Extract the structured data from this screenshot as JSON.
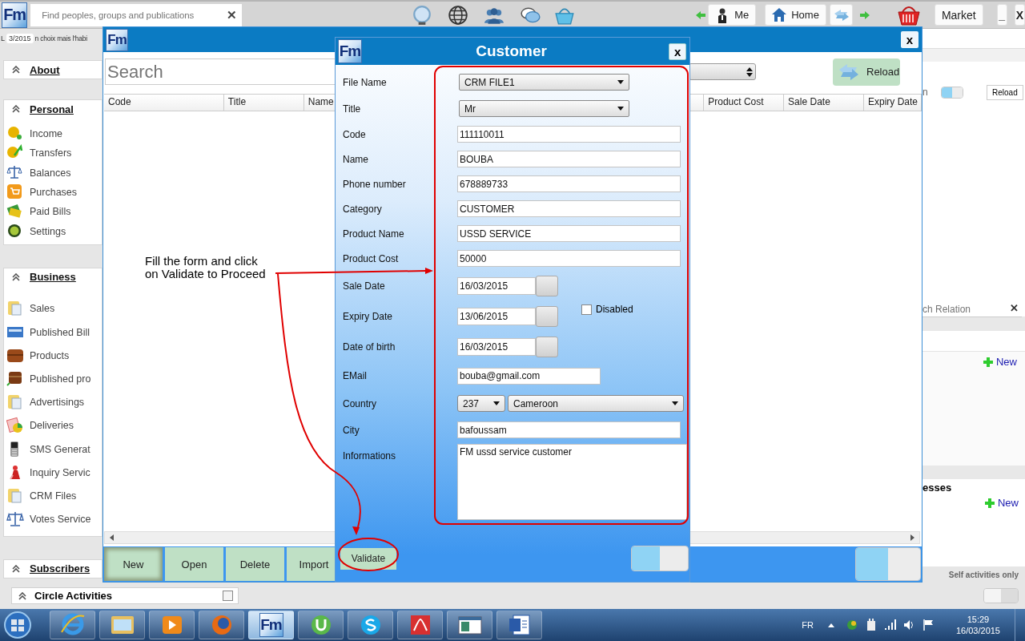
{
  "top_bar": {
    "logo": "Fm",
    "search": {
      "placeholder": "Find peoples, groups and publications",
      "clear": "✕"
    },
    "nav": [
      {
        "label": "Me"
      },
      {
        "label": "Home"
      }
    ],
    "market": "Market",
    "window_buttons": [
      "_",
      "X"
    ]
  },
  "sidebar": {
    "snippet_start": "L",
    "date_badge": "3/2015",
    "snippet": "n choix mais l'habi",
    "sections": [
      {
        "title": "About"
      },
      {
        "title": "Personal",
        "items": [
          "Income",
          "Transfers",
          "Balances",
          "Purchases",
          "Paid Bills",
          "Settings"
        ]
      },
      {
        "title": "Business",
        "items": [
          "Sales",
          "Published Bill",
          "Products",
          "Published pro",
          "Advertisings",
          "Deliveries",
          "SMS Generat",
          "Inquiry Servic",
          "CRM Files",
          "Votes Service"
        ]
      },
      {
        "title": "Subscribers"
      }
    ]
  },
  "circle_activities": {
    "title": "Circle Activities",
    "checked": false
  },
  "right_pane": {
    "fragment": "n",
    "toggle": {
      "on": true
    },
    "reload": "Reload",
    "relation_search": {
      "placeholder": "ch Relation",
      "clear": "✕"
    },
    "new_links": [
      "New",
      "New"
    ],
    "section_fragment": "esses",
    "footer_note": "Self activities only",
    "footer_toggle": {
      "on": false
    }
  },
  "crm_window": {
    "logo": "Fm",
    "close": "x",
    "search": {
      "placeholder": "Search"
    },
    "reload": "Reload",
    "columns": [
      "Code",
      "Title",
      "Name",
      "Product Cost",
      "Sale Date",
      "Expiry Date"
    ],
    "buttons": [
      {
        "label": "New",
        "selected": true
      },
      {
        "label": "Open",
        "selected": false
      },
      {
        "label": "Delete",
        "selected": false
      },
      {
        "label": "Import",
        "selected": false
      }
    ],
    "toggle": {
      "on": true
    }
  },
  "dialog": {
    "logo": "Fm",
    "title": "Customer",
    "close": "x",
    "fields": [
      {
        "label": "File Name",
        "kind": "select",
        "value": "CRM FILE1"
      },
      {
        "label": "Title",
        "kind": "select",
        "value": "Mr"
      },
      {
        "label": "Code",
        "kind": "text",
        "value": "111110011"
      },
      {
        "label": "Name",
        "kind": "text",
        "value": "BOUBA"
      },
      {
        "label": "Phone number",
        "kind": "text",
        "value": "678889733"
      },
      {
        "label": "Category",
        "kind": "text",
        "value": "CUSTOMER"
      },
      {
        "label": "Product Name",
        "kind": "text",
        "value": "USSD SERVICE"
      },
      {
        "label": "Product Cost",
        "kind": "text",
        "value": "50000"
      },
      {
        "label": "Sale Date",
        "kind": "date",
        "value": "16/03/2015"
      },
      {
        "label": "Expiry Date",
        "kind": "date",
        "value": "13/06/2015",
        "checkbox": {
          "label": "Disabled",
          "checked": false
        }
      },
      {
        "label": "Date of birth",
        "kind": "date",
        "value": "16/03/2015"
      },
      {
        "label": "EMail",
        "kind": "email",
        "value": "bouba@gmail.com"
      },
      {
        "label": "Country",
        "kind": "country",
        "code": "237",
        "value": "Cameroon"
      },
      {
        "label": "City",
        "kind": "text",
        "value": "bafoussam"
      },
      {
        "label": "Informations",
        "kind": "textarea",
        "value": "FM ussd service customer"
      }
    ],
    "validate": "Validate",
    "toggle": {
      "on": true
    }
  },
  "annotation": {
    "text": "Fill the form and click on Validate to Proceed"
  },
  "taskbar": {
    "apps": [
      {
        "kind": "browser",
        "selected": false
      },
      {
        "kind": "folder",
        "selected": false
      },
      {
        "kind": "media",
        "selected": false
      },
      {
        "kind": "firefox",
        "selected": false
      },
      {
        "kind": "fm",
        "label": "Fm",
        "selected": true
      },
      {
        "kind": "torrent",
        "selected": false
      },
      {
        "kind": "skype",
        "selected": false
      },
      {
        "kind": "pdf",
        "selected": false
      },
      {
        "kind": "window",
        "selected": false
      },
      {
        "kind": "word",
        "selected": false
      }
    ],
    "language": "FR",
    "time": "15:29",
    "date": "16/03/2015"
  }
}
